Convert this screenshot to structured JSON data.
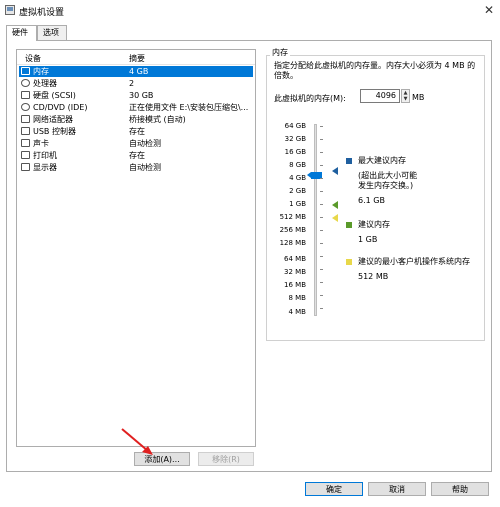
{
  "window": {
    "title": "虚拟机设置",
    "close_glyph": "✕"
  },
  "tabs": [
    {
      "label": "硬件"
    },
    {
      "label": "选项"
    }
  ],
  "device_list": {
    "headers": {
      "device": "设备",
      "summary": "摘要"
    },
    "rows": [
      {
        "name": "内存",
        "summary": "4 GB",
        "selected": true,
        "icon": "memory-icon"
      },
      {
        "name": "处理器",
        "summary": "2",
        "icon": "cpu-icon"
      },
      {
        "name": "硬盘 (SCSI)",
        "summary": "30 GB",
        "icon": "hard-disk-icon"
      },
      {
        "name": "CD/DVD (IDE)",
        "summary": "正在使用文件 E:\\安装包压缩包\\...",
        "icon": "cd-dvd-icon"
      },
      {
        "name": "网络适配器",
        "summary": "桥接模式 (自动)",
        "icon": "network-adapter-icon"
      },
      {
        "name": "USB 控制器",
        "summary": "存在",
        "icon": "usb-icon"
      },
      {
        "name": "声卡",
        "summary": "自动检测",
        "icon": "sound-card-icon"
      },
      {
        "name": "打印机",
        "summary": "存在",
        "icon": "printer-icon"
      },
      {
        "name": "显示器",
        "summary": "自动检测",
        "icon": "monitor-icon"
      }
    ]
  },
  "buttons": {
    "add": "添加(A)...",
    "remove": "移除(R)",
    "ok": "确定",
    "cancel": "取消",
    "help": "帮助"
  },
  "memory": {
    "group_title": "内存",
    "description": "指定分配给此虚拟机的内存量。内存大小必须为 4 MB 的倍数。",
    "field_label": "此虚拟机的内存(M):",
    "value": "4096",
    "unit": "MB",
    "scale_labels": [
      "64 GB",
      "32 GB",
      "16 GB",
      "8 GB",
      "4 GB",
      "2 GB",
      "1 GB",
      "512 MB",
      "256 MB",
      "128 MB",
      "64 MB",
      "32 MB",
      "16 MB",
      "8 MB",
      "4 MB"
    ],
    "legend": {
      "max": {
        "title": "最大建议内存",
        "note1": "(超出此大小可能",
        "note2": "发生内存交换。)",
        "value": "6.1 GB"
      },
      "recommended": {
        "title": "建议内存",
        "value": "1 GB"
      },
      "min_guest": {
        "title": "建议的最小客户机操作系统内存",
        "value": "512 MB"
      }
    }
  },
  "colors": {
    "accent": "#0078d7",
    "max_marker": "#1f5f9f",
    "recommended_marker": "#5a9a2a",
    "min_marker": "#e8d84a",
    "arrow": "#e02020"
  }
}
